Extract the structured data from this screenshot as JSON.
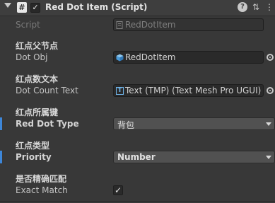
{
  "component": {
    "title": "Red Dot Item (Script)",
    "script_icon_glyph": "#",
    "enabled": true
  },
  "header_buttons": {
    "help": "?",
    "presets": "⇅",
    "menu": "⋮"
  },
  "script_field": {
    "label": "Script",
    "value": "RedDotItem"
  },
  "dot_obj": {
    "header": "红点父节点",
    "label": "Dot Obj",
    "value": "RedDotItem",
    "icon": "prefab-cube-icon"
  },
  "dot_count_text": {
    "header": "红点数文本",
    "label": "Dot Count Text",
    "value": "Text (TMP) (Text Mesh Pro UGUI)",
    "icon": "tmp-text-icon",
    "icon_glyph": "T"
  },
  "red_dot_type": {
    "header": "红点所属键",
    "label": "Red Dot Type",
    "value": "背包"
  },
  "priority": {
    "header": "红点类型",
    "label": "Priority",
    "value": "Number"
  },
  "exact_match": {
    "header": "是否精确匹配",
    "label": "Exact Match",
    "checked": true,
    "check_glyph": "✓"
  },
  "colors": {
    "background": "#383838",
    "accent": "#3d86d8",
    "field_bg": "#2a2a2a",
    "dropdown_bg": "#515151"
  }
}
